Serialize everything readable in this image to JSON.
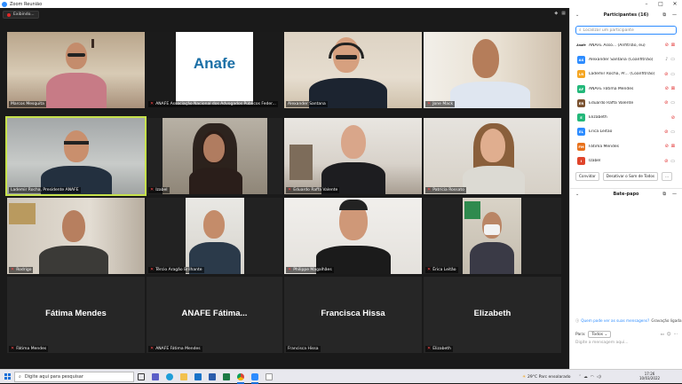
{
  "window": {
    "title": "Zoom Reunião"
  },
  "viewing": {
    "label": "Exibindo..."
  },
  "tiles": [
    {
      "name": "Marcos Mesquita",
      "mic_off": false
    },
    {
      "name": "ANAFE Associação Nacional dos Advogados Públicos Feder...",
      "mic_off": true,
      "logo": "Anafe"
    },
    {
      "name": "Alexander Santana",
      "mic_off": false
    },
    {
      "name": "Jone Mack",
      "mic_off": true
    },
    {
      "name": "Lademir Rocha, Presidente ANAFE",
      "mic_off": true
    },
    {
      "name": "Izabel",
      "mic_off": true
    },
    {
      "name": "Eduardo Raffa Valente",
      "mic_off": true
    },
    {
      "name": "Patrícia Rossato",
      "mic_off": true
    },
    {
      "name": "Rodrigo",
      "mic_off": true
    },
    {
      "name": "Tércio Aragão Brilhante",
      "mic_off": true
    },
    {
      "name": "Philippe Magalhães",
      "mic_off": true
    },
    {
      "name": "Érica Leitão",
      "mic_off": true
    },
    {
      "name": "Fátima Mendes",
      "mic_off": true,
      "big": "Fátima Mendes"
    },
    {
      "name": "ANAFE Fátima Mendes",
      "mic_off": true,
      "big": "ANAFE  Fátima..."
    },
    {
      "name": "Francisca Hissa",
      "mic_off": false,
      "big": "Francisca Hissa"
    },
    {
      "name": "Elizabeth",
      "mic_off": true,
      "big": "Elizabeth"
    }
  ],
  "participants": {
    "title": "Participantes (16)",
    "search_placeholder": "Localizar um participante",
    "list": [
      {
        "initials": "Anafe",
        "label": "ANAFE Asso... (Anfitrião, eu)",
        "color": "#ffffff",
        "mic": "off",
        "cam": "off"
      },
      {
        "initials": "AS",
        "label": "Alexander Santana (Coanfitrião)",
        "color": "#2d8cff",
        "mic": "on",
        "cam": "on"
      },
      {
        "initials": "LR",
        "label": "Lademir Rocha, Pr... (Coanfitrião)",
        "color": "#f5a623",
        "mic": "off",
        "cam": "on"
      },
      {
        "initials": "AF",
        "label": "ANAFE Fátima Mendes",
        "color": "#23b87a",
        "mic": "off",
        "cam": "off"
      },
      {
        "initials": "ER",
        "label": "Eduardo Raffa Valente",
        "color": "#7a5230",
        "mic": "off",
        "cam": "on"
      },
      {
        "initials": "E",
        "label": "Elizabeth",
        "color": "#23b87a",
        "mic": "off",
        "cam": ""
      },
      {
        "initials": "EL",
        "label": "Erica Leitao",
        "color": "#2d8cff",
        "mic": "off",
        "cam": "on"
      },
      {
        "initials": "FM",
        "label": "Fátima Mendes",
        "color": "#e8711b",
        "mic": "off",
        "cam": "off"
      },
      {
        "initials": "I",
        "label": "Izabel",
        "color": "#e0452b",
        "mic": "off",
        "cam": "on"
      }
    ],
    "buttons": {
      "invite": "Convidar",
      "mute_all": "Desativar o Som de Todos",
      "more": "..."
    }
  },
  "chat": {
    "title": "Bate-papo",
    "who_can_see": "Quem pode ver as suas mensagens?",
    "recording": "Gravação ligada",
    "to_label": "Para:",
    "to_value": "Todos",
    "message_placeholder": "Digite a mensagem aqui..."
  },
  "taskbar": {
    "search_placeholder": "Digite aqui para pesquisar",
    "weather": "29°C  Parc ensolarado",
    "time": "17:26",
    "date": "10/03/2022"
  },
  "colors": {
    "accent": "#2d8cff",
    "active_speaker": "#c6e14b",
    "muted": "#e02828"
  }
}
